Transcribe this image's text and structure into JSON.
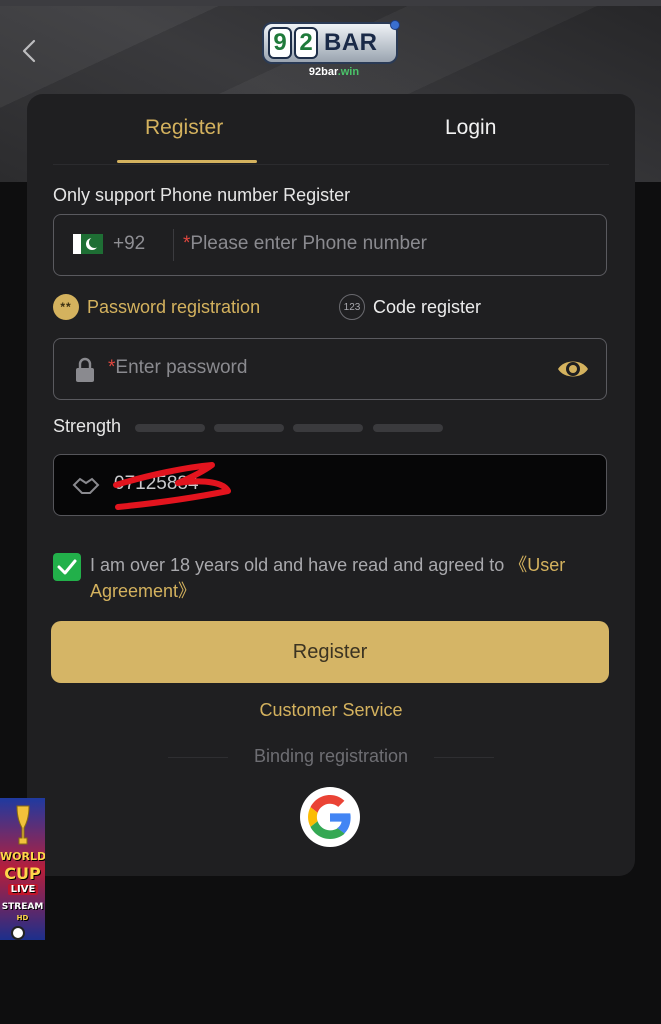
{
  "header": {
    "logo_digit_1": "9",
    "logo_digit_2": "2",
    "logo_word": "BAR",
    "logo_sub_prefix": "92",
    "logo_sub_main": "bar",
    "logo_sub_suffix": ".win",
    "back_icon": "chevron-left-icon"
  },
  "tabs": [
    {
      "label": "Register",
      "active": true
    },
    {
      "label": "Login",
      "active": false
    }
  ],
  "form": {
    "support_text": "Only support Phone number Register",
    "phone": {
      "country_code": "+92",
      "required_mark": "*",
      "placeholder": "Please enter Phone number",
      "flag_icon": "pakistan-flag-icon"
    },
    "reg_options": {
      "password_icon_text": "**",
      "password_label": "Password registration",
      "code_icon_text": "123",
      "code_label": "Code register"
    },
    "password": {
      "required_mark": "*",
      "placeholder": "Enter password",
      "lock_icon": "lock-icon",
      "eye_icon": "eye-icon"
    },
    "strength_label": "Strength",
    "strength_level": 0,
    "invite": {
      "value": "07125884",
      "icon": "handshake-icon"
    },
    "agreement": {
      "checked": true,
      "text": "I am over 18 years old and have read and agreed to ",
      "link": "《User Agreement》"
    },
    "register_button": "Register",
    "customer_service": "Customer Service",
    "binding_text": "Binding registration"
  },
  "colors": {
    "accent": "#d4b25e",
    "card_bg": "#1f1f21",
    "check_green": "#22b04a",
    "required_red": "#e0473f"
  },
  "banner": {
    "line1": "WORLD",
    "line2": "CUP",
    "line3": "LIVE",
    "line4": "STREAM",
    "line5": "HD"
  }
}
